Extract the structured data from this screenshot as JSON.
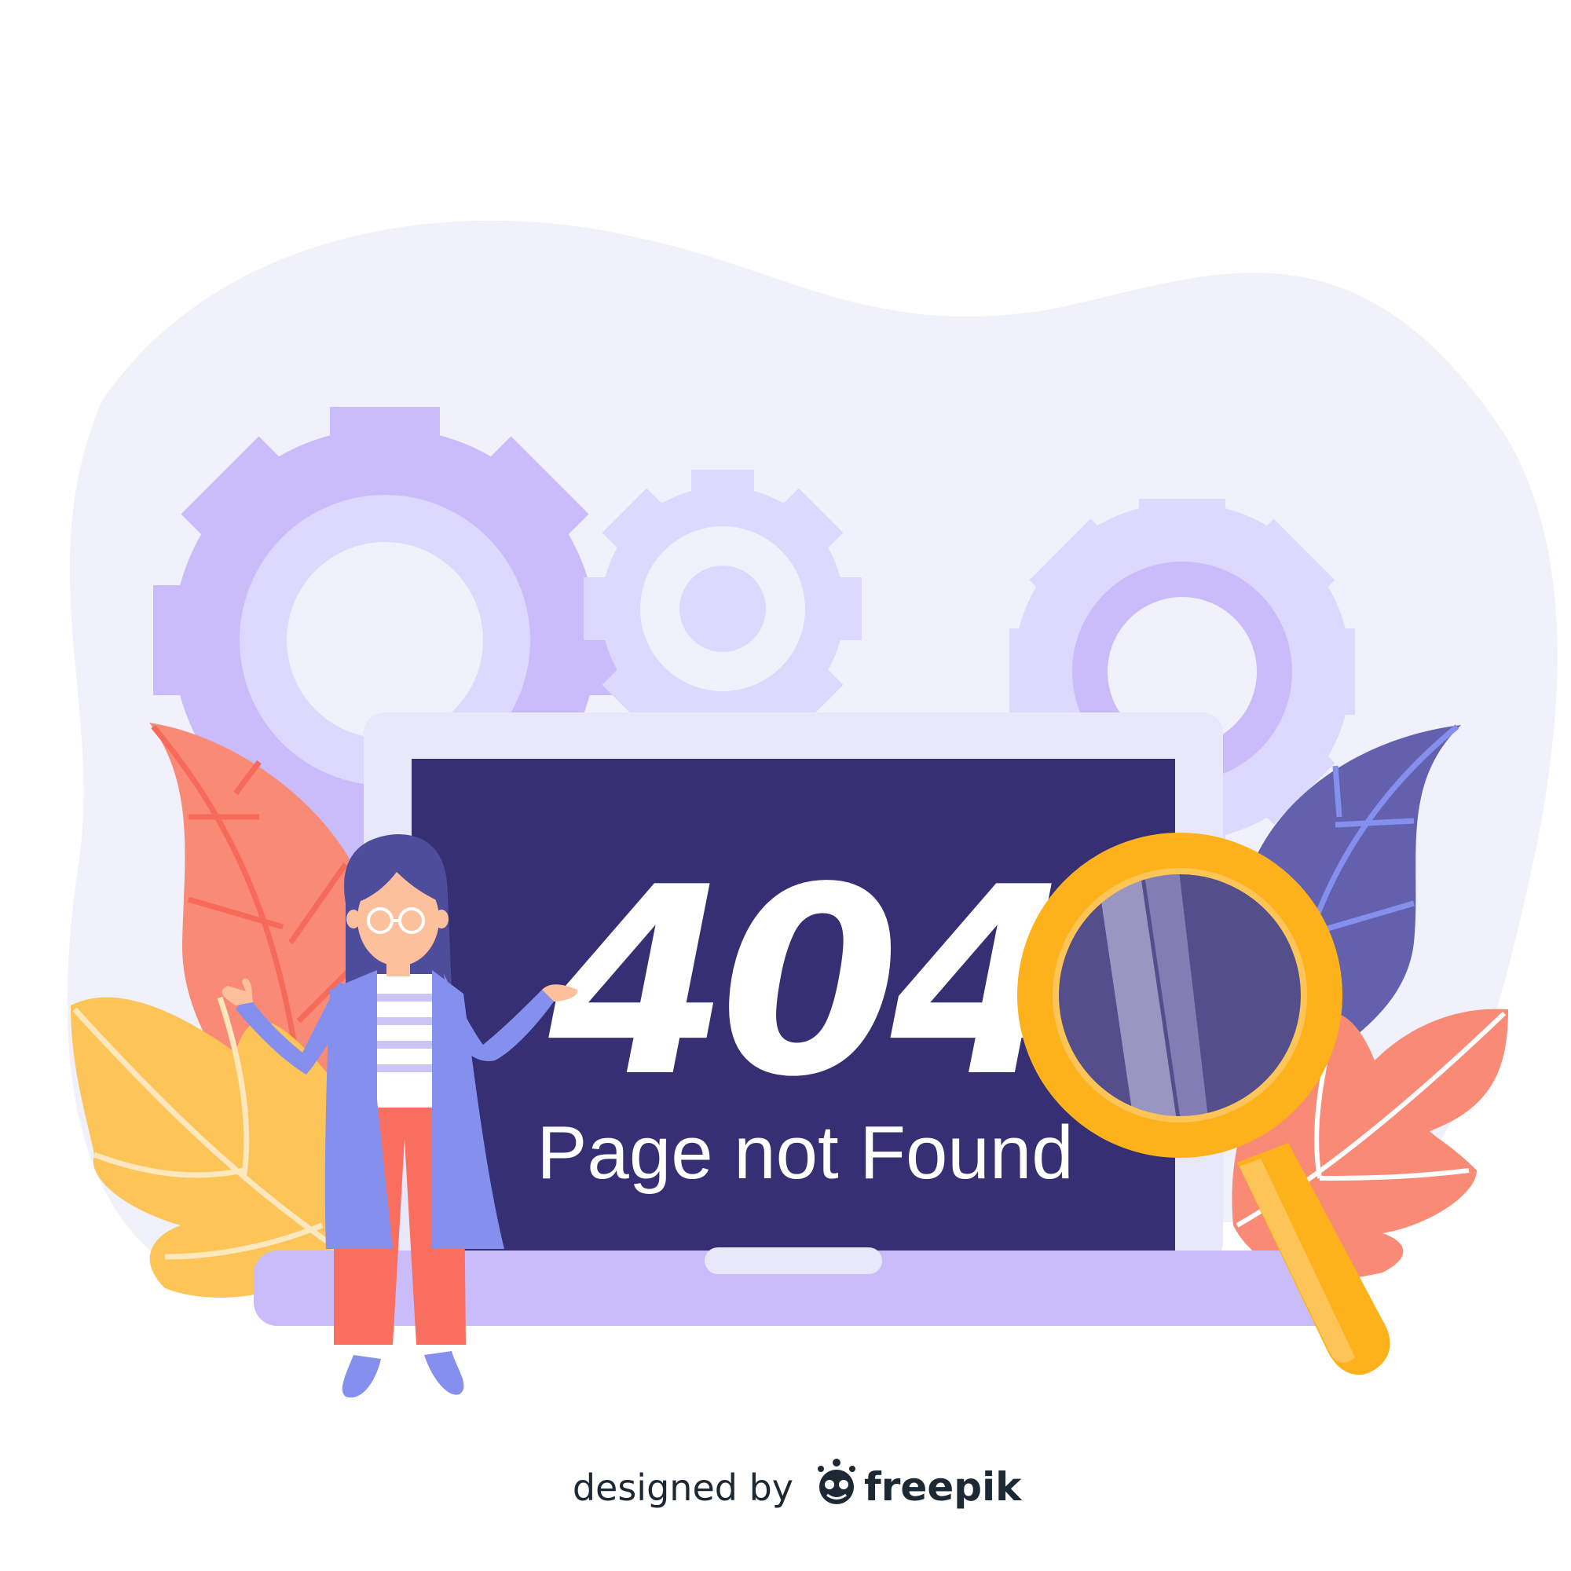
{
  "error": {
    "code": "404",
    "message": "Page not Found"
  },
  "credit": {
    "prefix": "designed by",
    "brand": "freepik"
  },
  "colors": {
    "background_blob": "#f1f1fc",
    "gear_large": "#cabcfa",
    "gear_small": "#ddd8fd",
    "screen": "#362f73",
    "laptop_frame": "#e9e8fb",
    "laptop_base": "#cabcfa",
    "leaf_coral": "#f98a76",
    "leaf_yellow": "#fdc458",
    "leaf_navy": "#6361ae",
    "magnifier": "#fdb21c",
    "text_white": "#ffffff",
    "credit_text": "#1c2833"
  },
  "icons": [
    "gear-icon",
    "laptop-icon",
    "magnifier-icon",
    "leaf-icon",
    "person-figure",
    "freepik-logo-icon"
  ]
}
